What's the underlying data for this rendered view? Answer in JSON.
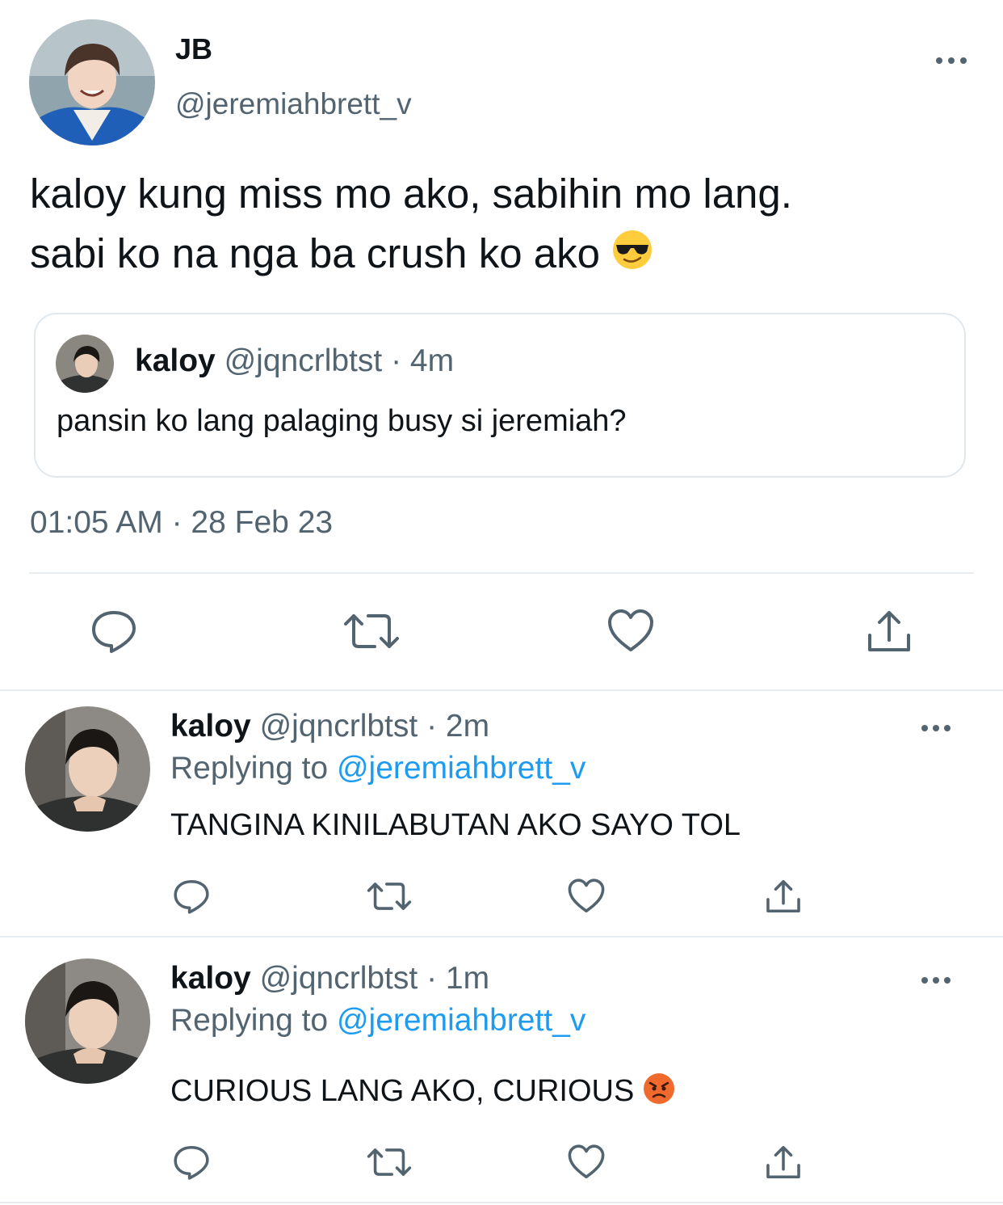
{
  "main_tweet": {
    "display_name": "JB",
    "handle": "@jeremiahbrett_v",
    "text_line1": "kaloy kung miss mo ako, sabihin mo lang.",
    "text_line2": "sabi ko na nga ba crush ko ako",
    "emoji": "sunglasses-emoji",
    "timestamp": "01:05 AM · 28 Feb 23",
    "quoted": {
      "display_name": "kaloy",
      "handle": "@jqncrlbtst",
      "time": "· 4m",
      "text": "pansin ko lang palaging busy si jeremiah?"
    }
  },
  "replies": [
    {
      "display_name": "kaloy",
      "handle": "@jqncrlbtst",
      "time": "· 2m",
      "replying_label": "Replying to",
      "replying_handle": "@jeremiahbrett_v",
      "text": "TANGINA KINILABUTAN AKO SAYO TOL",
      "emoji": ""
    },
    {
      "display_name": "kaloy",
      "handle": "@jqncrlbtst",
      "time": "· 1m",
      "replying_label": "Replying to",
      "replying_handle": "@jeremiahbrett_v",
      "text": "CURIOUS LANG AKO, CURIOUS",
      "emoji": "angry-face-emoji"
    }
  ],
  "actions": [
    "reply-icon",
    "retweet-icon",
    "like-icon",
    "share-icon"
  ],
  "colors": {
    "text": "#0f1419",
    "secondary": "#536471",
    "link": "#1d9bf0",
    "border": "#e1e8ed"
  }
}
